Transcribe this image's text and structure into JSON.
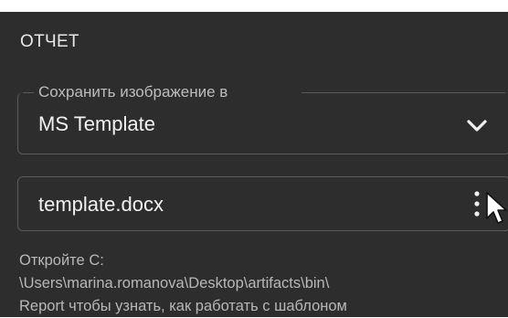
{
  "section": {
    "title": "ОТЧЕТ"
  },
  "save_image_select": {
    "label": "Сохранить изображение в",
    "value": "MS Template",
    "icon": "chevron-down-icon"
  },
  "template_file": {
    "value": "template.docx",
    "menu_icon": "more-vert-icon"
  },
  "hint": {
    "line1": "Откройте C:",
    "line2": "\\Users\\marina.romanova\\Desktop\\artifacts\\bin\\",
    "line3": "Report чтобы узнать, как работать с шаблоном"
  },
  "colors": {
    "panel_bg": "#2d2d2d",
    "text": "#e6e6e6",
    "muted_text": "#b8b8b8",
    "outline": "#5a5a5a"
  }
}
